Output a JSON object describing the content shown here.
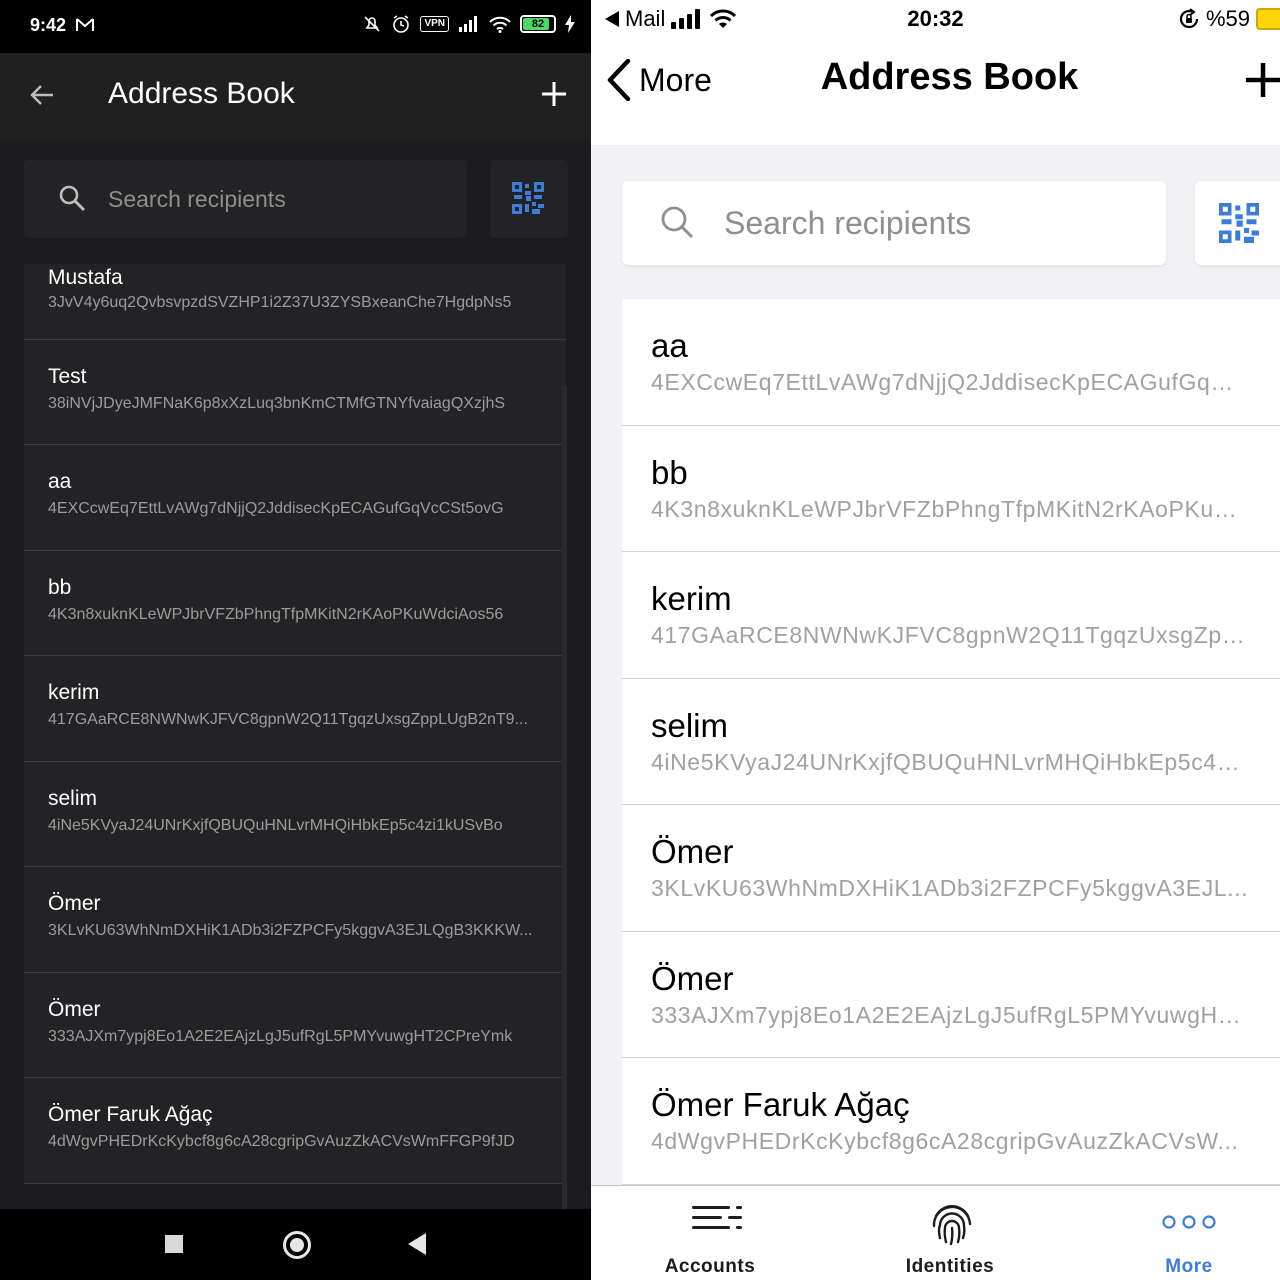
{
  "android": {
    "status": {
      "time": "9:42",
      "vpn": "VPN",
      "battery": "82"
    },
    "header": {
      "title": "Address Book"
    },
    "search": {
      "placeholder": "Search recipients"
    },
    "contacts": [
      {
        "name": "Mustafa",
        "address": "3JvV4y6uq2QvbsvpzdSVZHP1i2Z37U3ZYSBxeanChe7HgdpNs5"
      },
      {
        "name": "Test",
        "address": "38iNVjJDyeJMFNaK6p8xXzLuq3bnKmCTMfGTNYfvaiagQXzjhS"
      },
      {
        "name": "aa",
        "address": "4EXCcwEq7EttLvAWg7dNjjQ2JddisecKpECAGufGqVcCSt5ovG"
      },
      {
        "name": "bb",
        "address": "4K3n8xuknKLeWPJbrVFZbPhngTfpMKitN2rKAoPKuWdciAos56"
      },
      {
        "name": "kerim",
        "address": "417GAaRCE8NWNwKJFVC8gpnW2Q11TgqzUxsgZppLUgB2nT9..."
      },
      {
        "name": "selim",
        "address": "4iNe5KVyaJ24UNrKxjfQBUQuHNLvrMHQiHbkEp5c4zi1kUSvBo"
      },
      {
        "name": "Ömer",
        "address": "3KLvKU63WhNmDXHiK1ADb3i2FZPCFy5kggvA3EJLQgB3KKKW..."
      },
      {
        "name": "Ömer",
        "address": "333AJXm7ypj8Eo1A2E2EAjzLgJ5ufRgL5PMYvuwgHT2CPreYmk"
      },
      {
        "name": "Ömer Faruk Ağaç",
        "address": "4dWgvPHEDrKcKybcf8g6cA28cgripGvAuzZkACVsWmFFGP9fJD"
      }
    ]
  },
  "ios": {
    "status": {
      "back_app": "Mail",
      "time": "20:32",
      "battery": "%59"
    },
    "header": {
      "back_label": "More",
      "title": "Address Book"
    },
    "search": {
      "placeholder": "Search recipients"
    },
    "contacts": [
      {
        "name": "aa",
        "address": "4EXCcwEq7EttLvAWg7dNjjQ2JddisecKpECAGufGqVc..."
      },
      {
        "name": "bb",
        "address": "4K3n8xuknKLeWPJbrVFZbPhngTfpMKitN2rKAoPKuW..."
      },
      {
        "name": "kerim",
        "address": "417GAaRCE8NWNwKJFVC8gpnW2Q11TgqzUxsgZpp..."
      },
      {
        "name": "selim",
        "address": "4iNe5KVyaJ24UNrKxjfQBUQuHNLvrMHQiHbkEp5c4z..."
      },
      {
        "name": "Ömer",
        "address": "3KLvKU63WhNmDXHiK1ADb3i2FZPCFy5kggvA3EJL..."
      },
      {
        "name": "Ömer",
        "address": "333AJXm7ypj8Eo1A2E2EAjzLgJ5ufRgL5PMYvuwgHT..."
      },
      {
        "name": "Ömer Faruk Ağaç",
        "address": "4dWgvPHEDrKcKybcf8g6cA28cgripGvAuzZkACVsW..."
      }
    ],
    "tabs": [
      {
        "label": "Accounts",
        "icon": "list-icon"
      },
      {
        "label": "Identities",
        "icon": "fingerprint-icon"
      },
      {
        "label": "More",
        "icon": "more-dots-icon",
        "active": true
      }
    ]
  },
  "colors": {
    "android_bg": "#1c1c1e",
    "qr_blue": "#3b7dd8",
    "ios_active": "#3b7dd8",
    "battery_green": "#4cd964",
    "battery_yellow": "#ffd60a"
  }
}
